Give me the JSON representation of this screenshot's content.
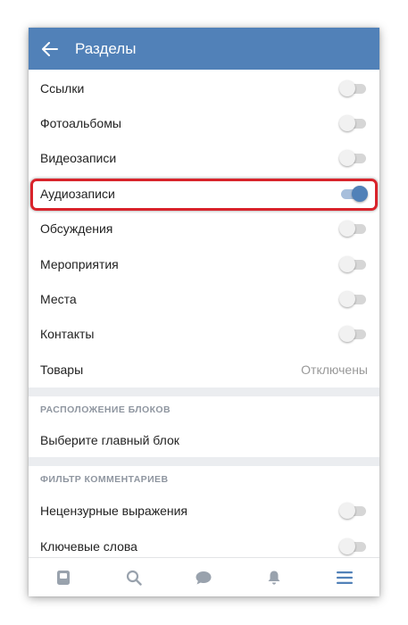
{
  "header": {
    "title": "Разделы"
  },
  "sections_list": [
    {
      "label": "Ссылки",
      "state": "off"
    },
    {
      "label": "Фотоальбомы",
      "state": "off"
    },
    {
      "label": "Видеозаписи",
      "state": "off"
    },
    {
      "label": "Аудиозаписи",
      "state": "on",
      "highlighted": true
    },
    {
      "label": "Обсуждения",
      "state": "off"
    },
    {
      "label": "Мероприятия",
      "state": "off"
    },
    {
      "label": "Места",
      "state": "off"
    },
    {
      "label": "Контакты",
      "state": "off"
    },
    {
      "label": "Товары",
      "value": "Отключены"
    }
  ],
  "blocks_section": {
    "heading": "РАСПОЛОЖЕНИЕ БЛОКОВ",
    "item_label": "Выберите главный блок"
  },
  "filter_section": {
    "heading": "ФИЛЬТР КОММЕНТАРИЕВ",
    "items": [
      {
        "label": "Нецензурные выражения",
        "state": "off"
      },
      {
        "label": "Ключевые слова",
        "state": "off"
      }
    ]
  },
  "tabbar": {
    "tabs": [
      "news-icon",
      "search-icon",
      "messages-icon",
      "notifications-icon",
      "menu-icon"
    ],
    "active_tab": "menu-icon"
  },
  "colors": {
    "header_bg": "#5181b8",
    "toggle_on": "#5181b8",
    "highlight_border": "#d9232b",
    "section_heading": "#8f96a0"
  }
}
